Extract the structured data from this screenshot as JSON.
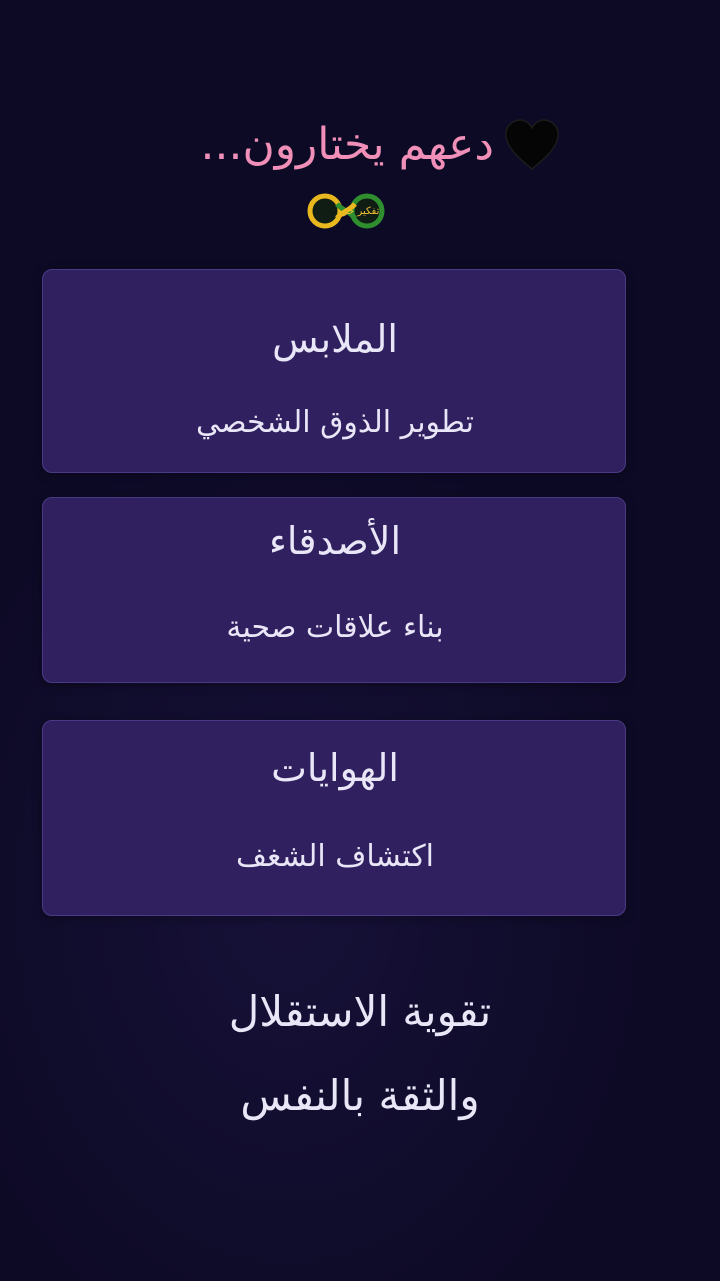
{
  "header": {
    "title": "دعهم يختارون...",
    "heart_icon": "black-heart-icon",
    "title_color": "#f08fb8"
  },
  "logo": {
    "icon": "infinity-logo-icon",
    "text": "تفكير حر"
  },
  "cards": [
    {
      "title": "الملابس",
      "subtitle": "تطوير الذوق الشخصي"
    },
    {
      "title": "الأصدقاء",
      "subtitle": "بناء علاقات صحية"
    },
    {
      "title": "الهوايات",
      "subtitle": "اكتشاف الشغف"
    }
  ],
  "footer": {
    "line1": "تقوية الاستقلال",
    "line2": "والثقة بالنفس"
  },
  "colors": {
    "background": "#0d0a26",
    "card": "#30205f",
    "card_border": "#4a3a86",
    "text": "#e9e6f7"
  }
}
